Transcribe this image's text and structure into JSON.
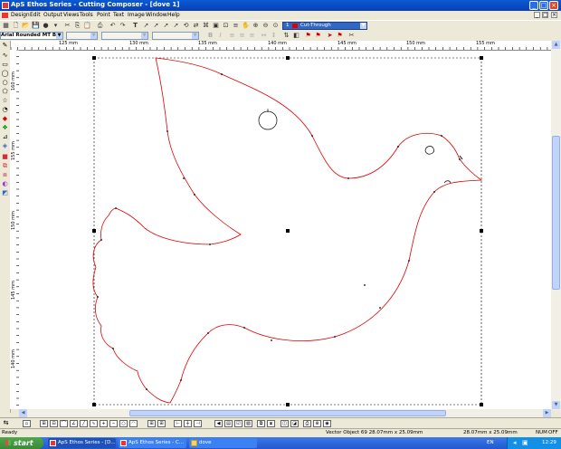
{
  "window": {
    "title": "ApS Ethos Series - Cutting Composer - [dove 1]",
    "min_glyph": "_",
    "max_glyph": "□",
    "close_glyph": "×"
  },
  "menu": [
    "Design",
    "Edit",
    "Output",
    "Views",
    "Tools",
    "Point",
    "Text",
    "Image",
    "Window",
    "Help"
  ],
  "mdi": {
    "min_glyph": "_",
    "max_glyph": "□",
    "close_glyph": "×"
  },
  "toolbar": {
    "layer_combo": {
      "number": "1",
      "label": "Cut-Through",
      "swatch_color": "#e00000"
    }
  },
  "format_bar": {
    "font_value": "Arial Rounded MT Bol"
  },
  "rulers": {
    "horizontal_labels": [
      "125 mm",
      "130 mm",
      "135 mm",
      "140 mm",
      "145 mm",
      "150 mm",
      "155 mm"
    ],
    "vertical_labels": [
      "160 mm",
      "155 mm",
      "150 mm",
      "145 mm",
      "140 mm"
    ]
  },
  "status": {
    "left": "Ready",
    "object_info": "Vector Object 69 28.07mm x 25.09mm",
    "size": "28.07mm x 25.09mm",
    "num": "NUM",
    "ovr": "OFF"
  },
  "taskbar": {
    "start": "start",
    "tasks": [
      "ApS Ethos Series - [D...",
      "ApS Ethos Series - C...",
      "dove"
    ],
    "language": "EN",
    "clock": "12:29"
  },
  "colors": {
    "cut_line": "#e00000",
    "titlebar": "#0b52cf",
    "taskbar": "#2457d0"
  }
}
